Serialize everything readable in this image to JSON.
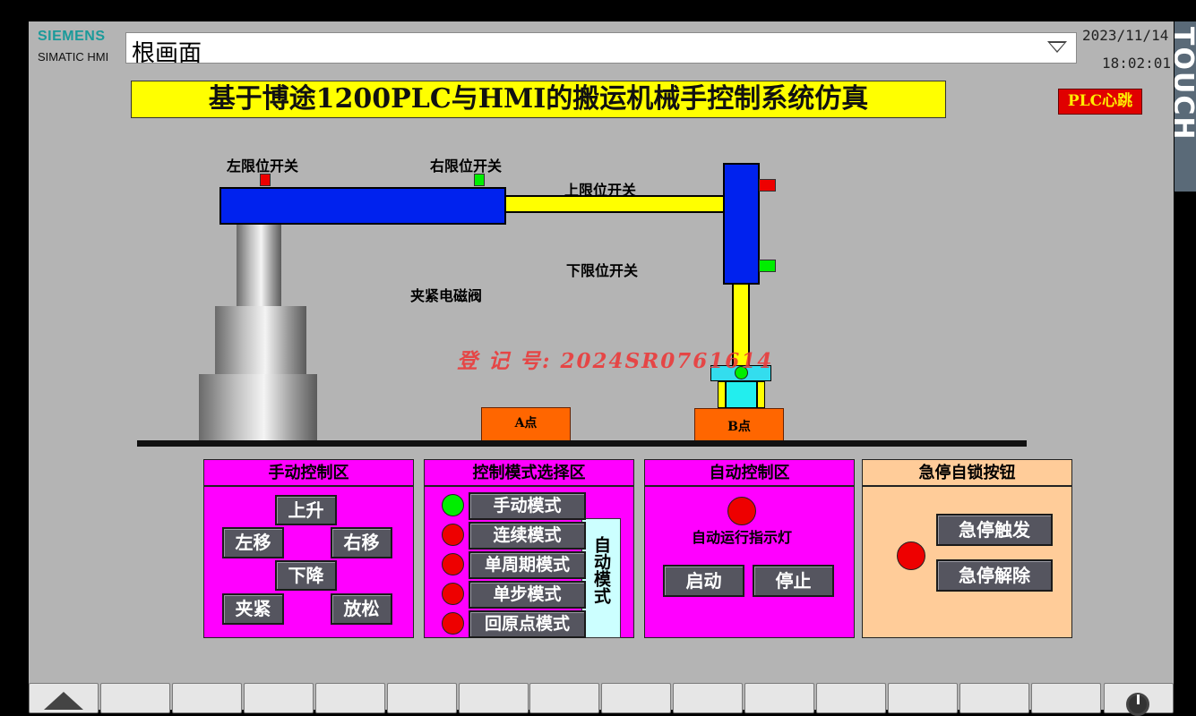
{
  "header": {
    "brand": "SIEMENS",
    "product": "SIMATIC HMI",
    "screen_name": "根画面",
    "date": "2023/11/14",
    "time": "18:02:01",
    "edge_text": "TOUCH"
  },
  "title": "基于博途1200PLC与HMI的搬运机械手控制系统仿真",
  "plc_heartbeat": "PLC心跳",
  "process": {
    "left_limit": "左限位开关",
    "right_limit": "右限位开关",
    "upper_limit": "上限位开关",
    "lower_limit": "下限位开关",
    "clamp_valve": "夹紧电磁阀",
    "point_a": "A点",
    "point_b": "B点",
    "watermark": "登 记 号:  2024SR0761614"
  },
  "manual": {
    "title": "手动控制区",
    "up": "上升",
    "left": "左移",
    "right": "右移",
    "down": "下降",
    "clamp": "夹紧",
    "release": "放松"
  },
  "mode": {
    "title": "控制模式选择区",
    "items": [
      {
        "label": "手动模式",
        "lamp": "#00ee00"
      },
      {
        "label": "连续模式",
        "lamp": "#ee0000"
      },
      {
        "label": "单周期模式",
        "lamp": "#ee0000"
      },
      {
        "label": "单步模式",
        "lamp": "#ee0000"
      },
      {
        "label": "回原点模式",
        "lamp": "#ee0000"
      }
    ],
    "auto_label": "自动模式"
  },
  "auto": {
    "title": "自动控制区",
    "indicator_label": "自动运行指示灯",
    "start": "启动",
    "stop": "停止"
  },
  "estop": {
    "title": "急停自锁按钮",
    "trigger": "急停触发",
    "release": "急停解除"
  },
  "colors": {
    "magenta": "#ff00ff",
    "peach": "#ffcc99",
    "arm_blue": "#0022ee",
    "beam_yellow": "#ffff00",
    "lamp_red": "#ee0000",
    "lamp_green": "#00ee00",
    "cyan": "#33ddee",
    "orange": "#ff6600"
  },
  "footer": {
    "home_icon": "home-arrow-icon",
    "power_icon": "power-icon"
  }
}
